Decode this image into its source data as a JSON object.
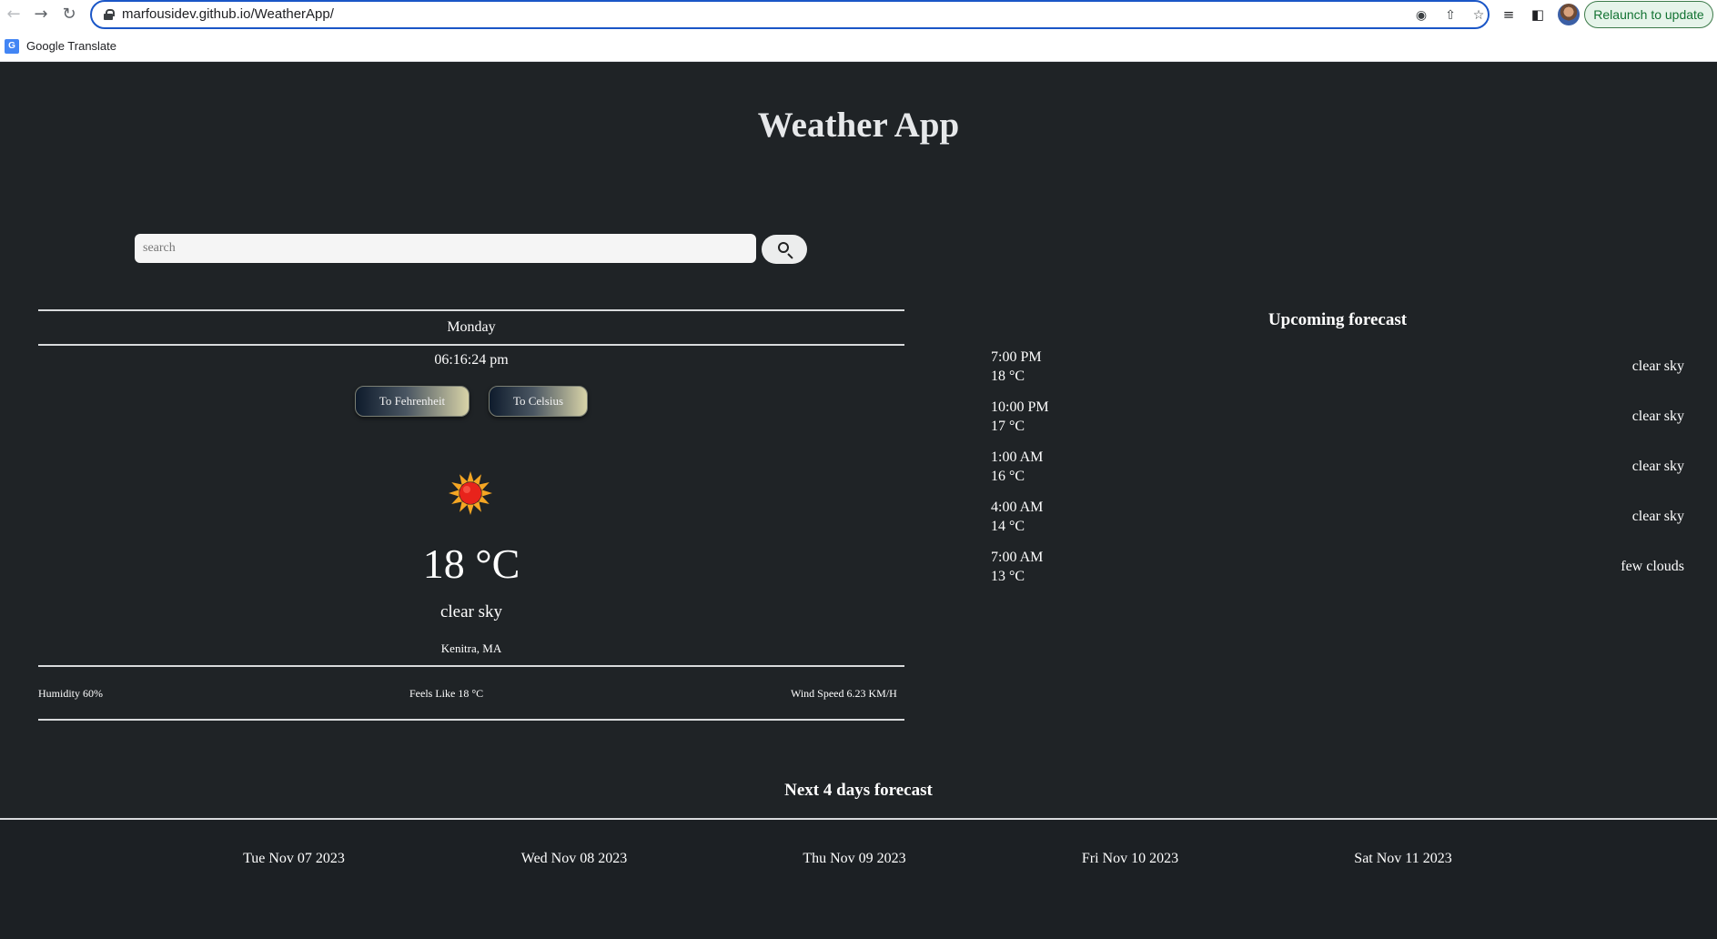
{
  "browser": {
    "url": "marfousidev.github.io/WeatherApp/",
    "relaunch_label": "Relaunch to update",
    "bookmark_label": "Google Translate",
    "bookmark_icon_letter": "G"
  },
  "app": {
    "title": "Weather App",
    "search_placeholder": "search"
  },
  "current": {
    "day": "Monday",
    "time": "06:16:24 pm",
    "to_fahrenheit_label": "To Fehrenheit",
    "to_celsius_label": "To Celsius",
    "icon": "sun-icon",
    "temperature": "18 °C",
    "description": "clear sky",
    "city": "Kenitra, MA",
    "humidity": "Humidity 60%",
    "feels_like": "Feels Like 18 °C",
    "wind_speed": "Wind Speed 6.23 KM/H"
  },
  "upcoming": {
    "title": "Upcoming forecast",
    "items": [
      {
        "time": "7:00 PM",
        "temp": "18 °C",
        "desc": "clear sky"
      },
      {
        "time": "10:00 PM",
        "temp": "17 °C",
        "desc": "clear sky"
      },
      {
        "time": "1:00 AM",
        "temp": "16 °C",
        "desc": "clear sky"
      },
      {
        "time": "4:00 AM",
        "temp": "14 °C",
        "desc": "clear sky"
      },
      {
        "time": "7:00 AM",
        "temp": "13 °C",
        "desc": "few clouds"
      }
    ]
  },
  "next_days": {
    "title": "Next 4 days forecast",
    "days": [
      "Tue Nov 07 2023",
      "Wed Nov 08 2023",
      "Thu Nov 09 2023",
      "Fri Nov 10 2023",
      "Sat Nov 11 2023"
    ]
  },
  "colors": {
    "background": "#1f2326",
    "omnibox_focus": "#1a56c7",
    "relaunch_green": "#137333",
    "sun_core": "#e8231b",
    "sun_rays": "#f5a623"
  }
}
